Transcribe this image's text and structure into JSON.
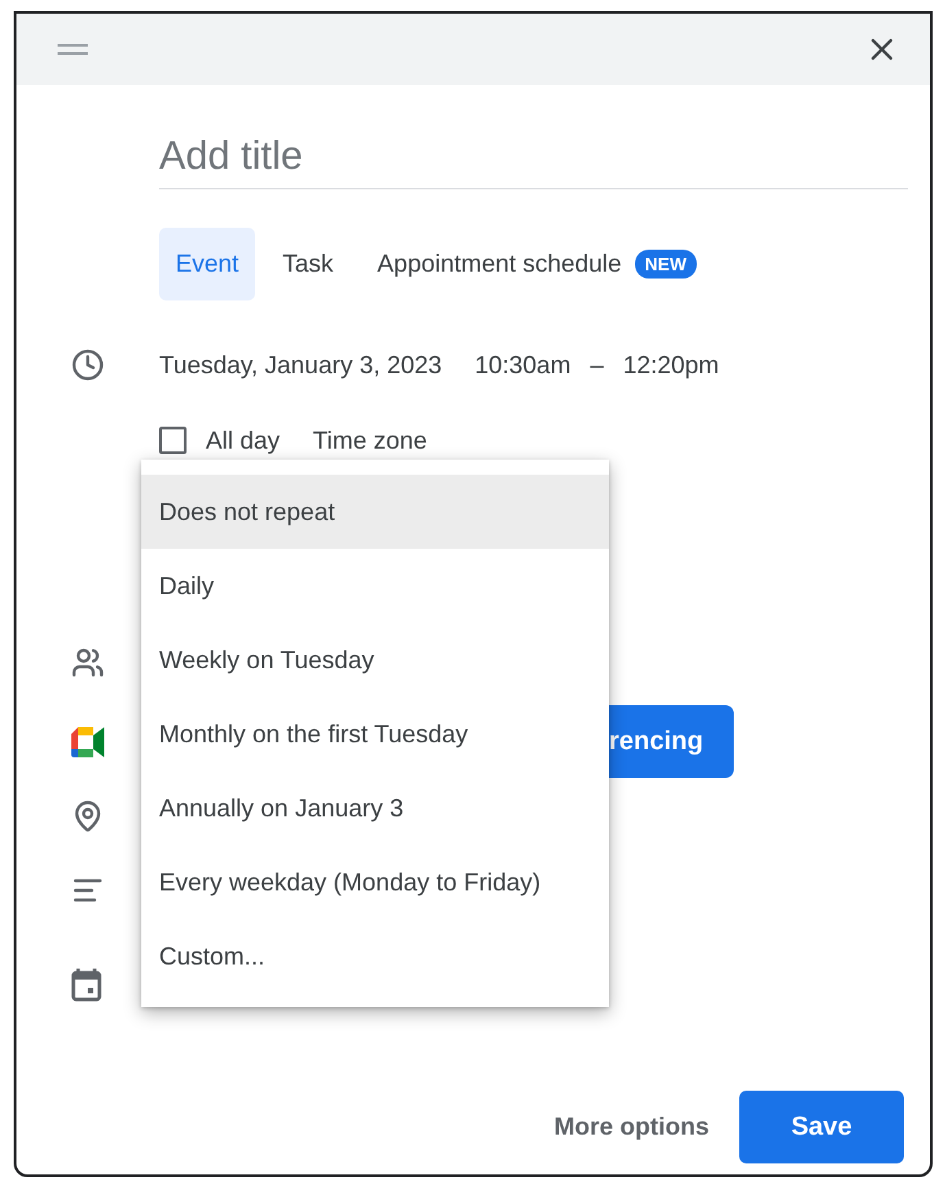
{
  "title_field": {
    "placeholder": "Add title"
  },
  "tabs": [
    {
      "label": "Event",
      "selected": true
    },
    {
      "label": "Task",
      "selected": false
    },
    {
      "label": "Appointment schedule",
      "selected": false,
      "badge": "NEW"
    }
  ],
  "date": "Tuesday, January 3, 2023",
  "start_time": "10:30am",
  "time_separator": "–",
  "end_time": "12:20pm",
  "all_day": {
    "label": "All day",
    "checked": false
  },
  "time_zone": "Time zone",
  "repeat_menu": [
    {
      "label": "Does not repeat",
      "selected": true
    },
    {
      "label": "Daily",
      "selected": false
    },
    {
      "label": "Weekly on Tuesday",
      "selected": false
    },
    {
      "label": "Monthly on the first Tuesday",
      "selected": false
    },
    {
      "label": "Annually on January 3",
      "selected": false
    },
    {
      "label": "Every weekday (Monday to Friday)",
      "selected": false
    },
    {
      "label": "Custom...",
      "selected": false
    }
  ],
  "conferencing_button": "rencing",
  "footer": {
    "more_options": "More options",
    "save": "Save"
  }
}
